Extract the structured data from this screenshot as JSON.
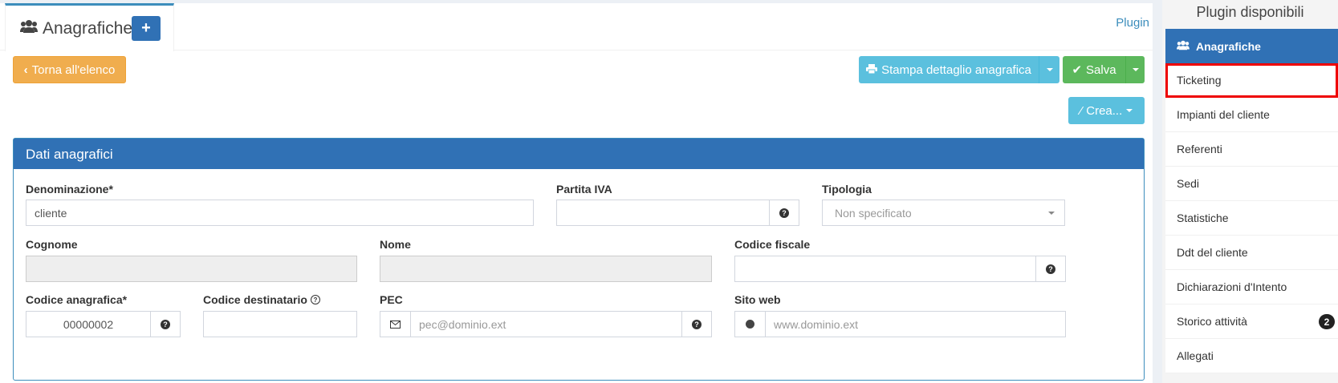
{
  "header": {
    "title": "Anagrafiche",
    "add_label": "+",
    "plugin_link": "Plugin"
  },
  "toolbar": {
    "back_label": "Torna all'elenco",
    "print_label": "Stampa dettaglio anagrafica",
    "save_label": "Salva",
    "crea_label": "Crea..."
  },
  "form": {
    "box_title": "Dati anagrafici",
    "denominazione": {
      "label": "Denominazione*",
      "value": "cliente"
    },
    "partita_iva": {
      "label": "Partita IVA",
      "value": ""
    },
    "tipologia": {
      "label": "Tipologia",
      "value": "Non specificato"
    },
    "cognome": {
      "label": "Cognome",
      "value": ""
    },
    "nome": {
      "label": "Nome",
      "value": ""
    },
    "codice_fiscale": {
      "label": "Codice fiscale",
      "value": ""
    },
    "codice_anagrafica": {
      "label": "Codice anagrafica*",
      "value": "00000002"
    },
    "codice_destinatario": {
      "label": "Codice destinatario",
      "value": ""
    },
    "pec": {
      "label": "PEC",
      "placeholder": "pec@dominio.ext"
    },
    "sito_web": {
      "label": "Sito web",
      "placeholder": "www.dominio.ext"
    }
  },
  "sidebar": {
    "title": "Plugin disponibili",
    "items": [
      {
        "label": "Anagrafiche"
      },
      {
        "label": "Ticketing"
      },
      {
        "label": "Impianti del cliente"
      },
      {
        "label": "Referenti"
      },
      {
        "label": "Sedi"
      },
      {
        "label": "Statistiche"
      },
      {
        "label": "Ddt del cliente"
      },
      {
        "label": "Dichiarazioni d'Intento"
      },
      {
        "label": "Storico attività",
        "badge": "2"
      },
      {
        "label": "Allegati"
      }
    ]
  }
}
